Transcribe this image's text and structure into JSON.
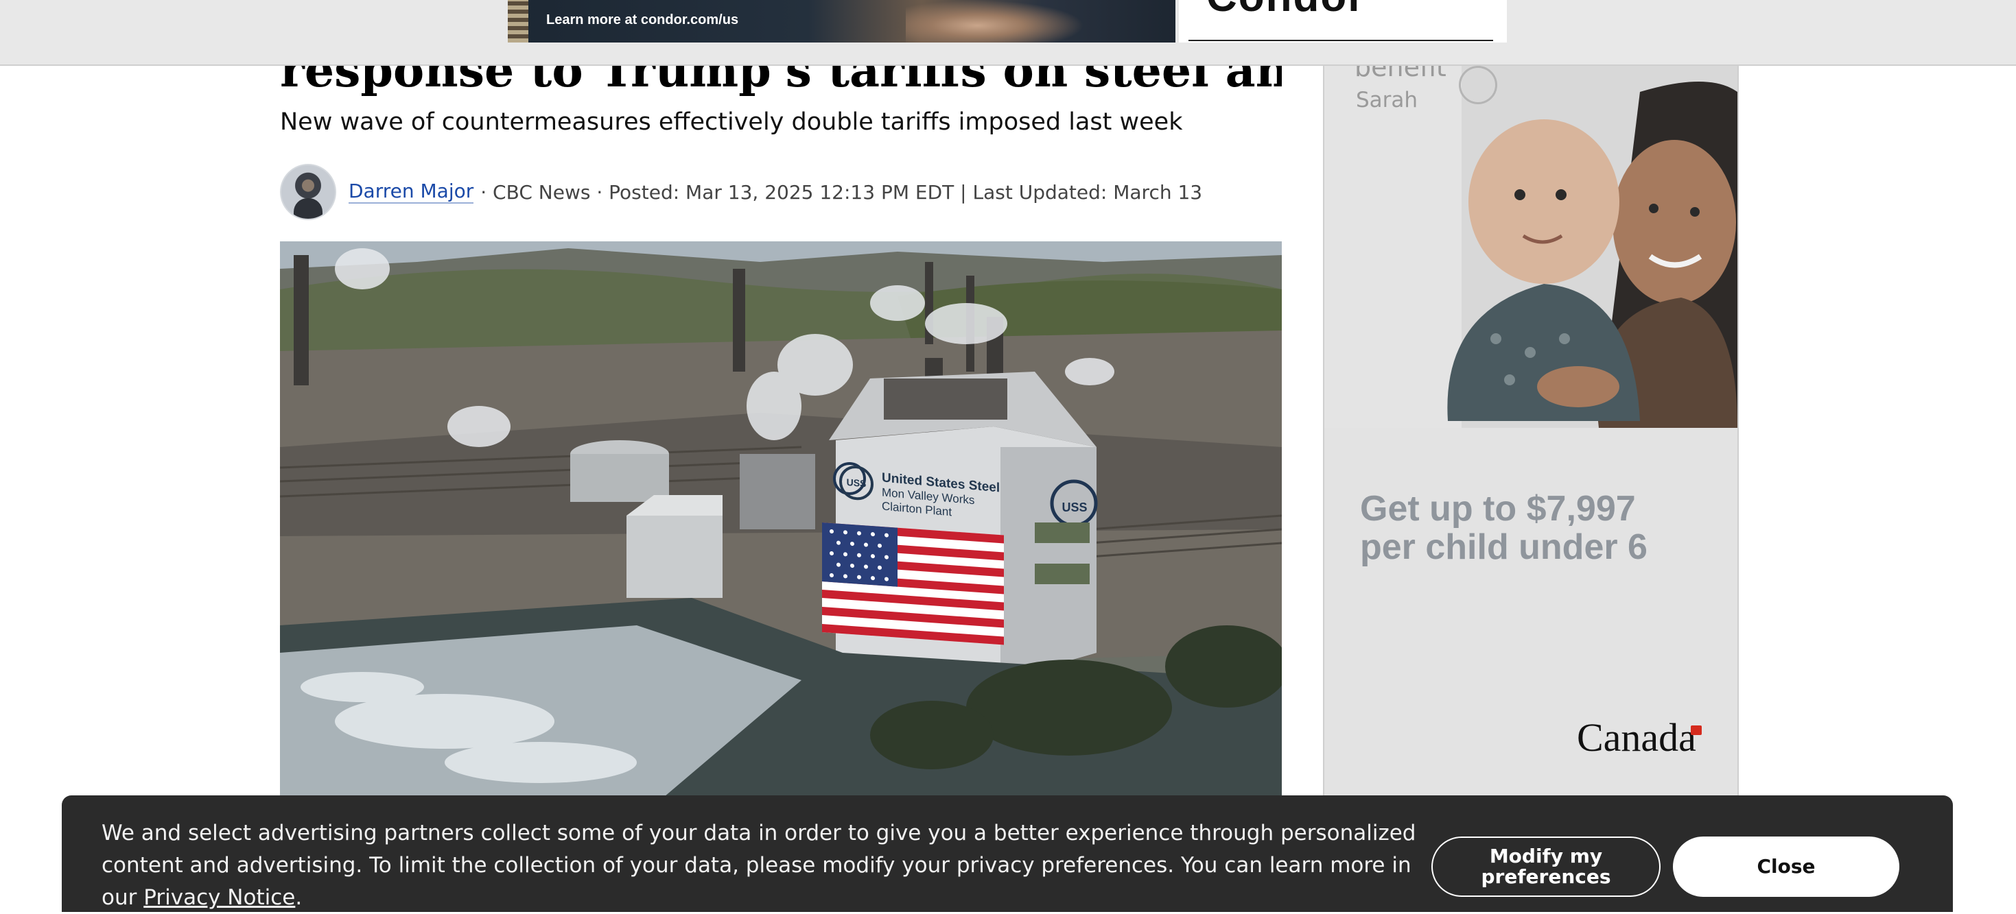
{
  "top_ad": {
    "cta_text": "Learn more at condor.com/us",
    "brand_partial": "Condor"
  },
  "article": {
    "headline": "response to Trump's tariffs on steel and aluminum",
    "subhead": "New wave of countermeasures effectively double tariffs imposed last week",
    "byline": {
      "author": "Darren Major",
      "meta": "· CBC News · Posted: Mar 13, 2025 12:13 PM EDT | Last Updated: March 13"
    },
    "hero_image": {
      "sign_line1": "United States Steel",
      "sign_line2": "Mon Valley Works",
      "sign_line3": "Clairton Plant",
      "logo_text": "USS"
    }
  },
  "side_ad": {
    "brand_partial": "benefit",
    "name": "Sarah",
    "headline_line1": "Get up to $7,997",
    "headline_line2": "per child under 6",
    "wordmark": "Canada"
  },
  "cookie_banner": {
    "message": "We and select advertising partners collect some of your data in order to give you a better experience through personalized content and advertising. To limit the collection of your data, please modify your privacy preferences. You can learn more in our ",
    "link": "Privacy Notice",
    "tail": ".",
    "modify_label": "Modify my preferences",
    "close_label": "Close"
  }
}
